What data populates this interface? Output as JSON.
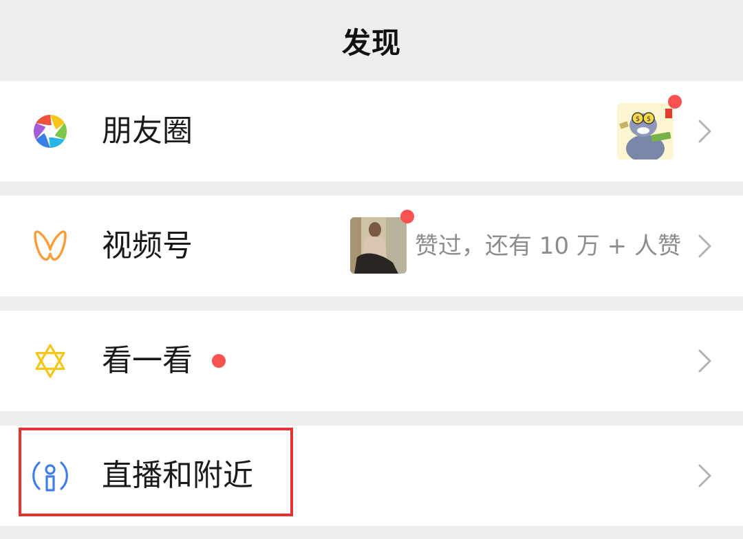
{
  "header": {
    "title": "发现"
  },
  "items": [
    {
      "label": "朋友圈",
      "icon": "moments-aperture-icon",
      "has_thumbnail": true,
      "thumbnail": "cat-money-sticker-thumbnail",
      "has_red_dot": true
    },
    {
      "label": "视频号",
      "icon": "channels-butterfly-icon",
      "has_thumbnail": true,
      "thumbnail": "video-photo-thumbnail",
      "has_red_dot": true,
      "sub_text": "赞过，还有 10 万 + 人赞"
    },
    {
      "label": "看一看",
      "icon": "top-stories-star-icon",
      "has_red_dot": true
    },
    {
      "label": "直播和附近",
      "icon": "live-nearby-icon",
      "highlighted": true
    }
  ],
  "colors": {
    "background": "#ededed",
    "row_background": "#ffffff",
    "red_dot": "#fa5151",
    "highlight_border": "#e8322d",
    "subtext": "#8c8c8c"
  }
}
